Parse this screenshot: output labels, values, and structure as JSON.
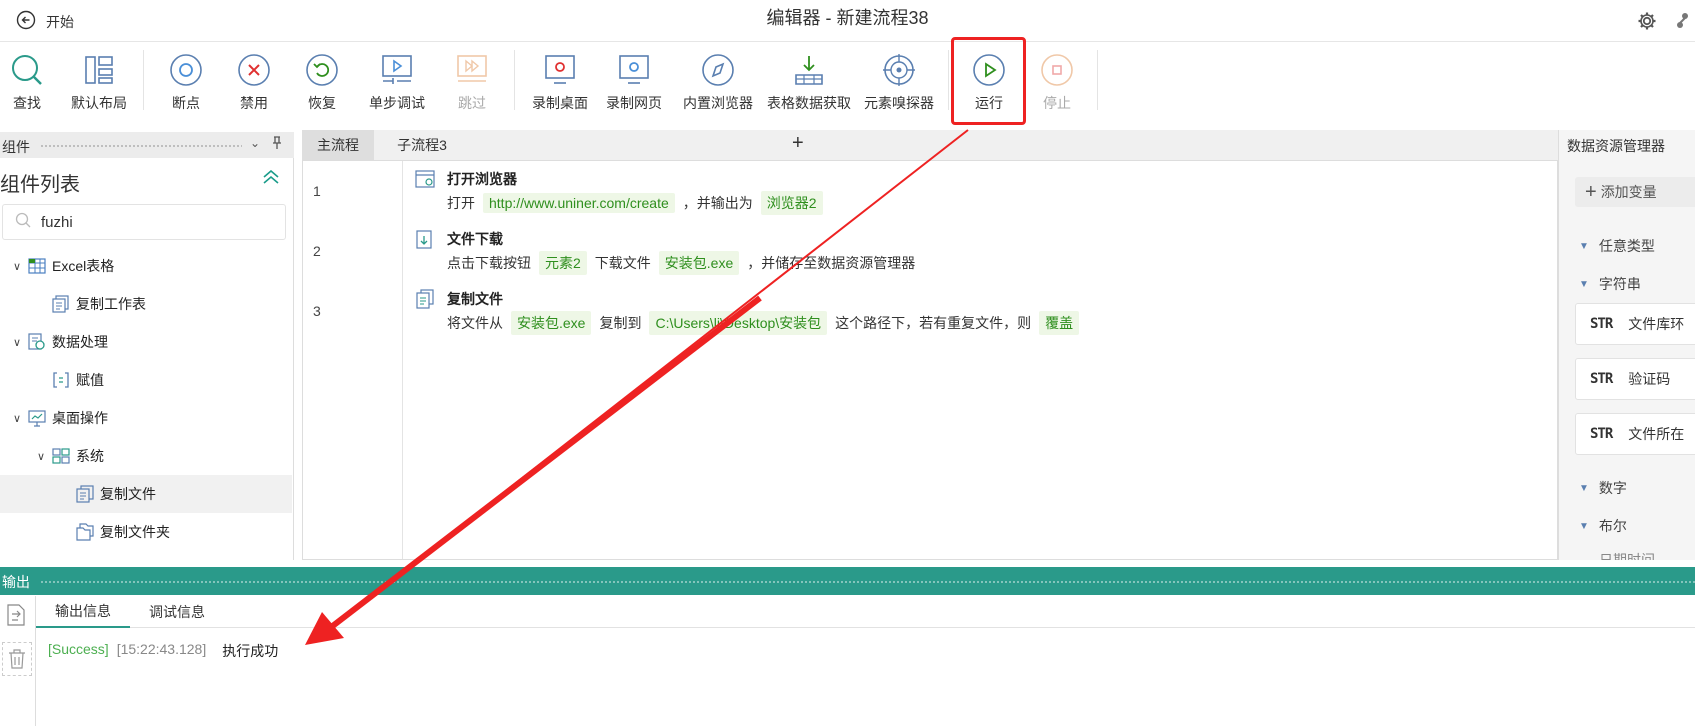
{
  "titlebar": {
    "back_label": "开始",
    "title": "编辑器 - 新建流程38"
  },
  "toolbar": {
    "items": [
      {
        "label": "查找",
        "icon": "search-icon"
      },
      {
        "label": "默认布局",
        "icon": "layout-icon"
      },
      {
        "label": "断点",
        "icon": "breakpoint-icon"
      },
      {
        "label": "禁用",
        "icon": "disable-icon"
      },
      {
        "label": "恢复",
        "icon": "restore-icon"
      },
      {
        "label": "单步调试",
        "icon": "step-debug-icon"
      },
      {
        "label": "跳过",
        "icon": "skip-icon",
        "disabled": true
      },
      {
        "label": "录制桌面",
        "icon": "record-desktop-icon"
      },
      {
        "label": "录制网页",
        "icon": "record-web-icon"
      },
      {
        "label": "内置浏览器",
        "icon": "browser-icon"
      },
      {
        "label": "表格数据获取",
        "icon": "table-data-icon"
      },
      {
        "label": "元素嗅探器",
        "icon": "element-sniffer-icon"
      },
      {
        "label": "运行",
        "icon": "run-icon"
      },
      {
        "label": "停止",
        "icon": "stop-icon",
        "disabled": true
      }
    ]
  },
  "left_panel": {
    "header": "组件",
    "title": "组件列表",
    "search_value": "fuzhi",
    "tree": [
      {
        "label": "Excel表格",
        "level": 0,
        "expanded": true,
        "icon": "excel-table-icon"
      },
      {
        "label": "复制工作表",
        "level": 1,
        "icon": "copy-sheet-icon"
      },
      {
        "label": "数据处理",
        "level": 0,
        "expanded": true,
        "icon": "data-processing-icon"
      },
      {
        "label": "赋值",
        "level": 1,
        "icon": "assign-icon"
      },
      {
        "label": "桌面操作",
        "level": 0,
        "expanded": true,
        "icon": "desktop-ops-icon"
      },
      {
        "label": "系统",
        "level": 1,
        "expanded": true,
        "icon": "system-icon"
      },
      {
        "label": "复制文件",
        "level": 2,
        "selected": true,
        "icon": "copy-file-icon"
      },
      {
        "label": "复制文件夹",
        "level": 2,
        "icon": "copy-folder-icon"
      }
    ]
  },
  "editor": {
    "tabs": [
      {
        "label": "主流程",
        "active": true
      },
      {
        "label": "子流程3",
        "active": false
      }
    ],
    "steps": [
      {
        "line": "1",
        "title": "打开浏览器",
        "icon": "open-browser-icon",
        "parts": [
          "打开",
          {
            "tok": "http://www.uniner.com/create"
          },
          "，并输出为",
          {
            "tok": "浏览器2"
          }
        ]
      },
      {
        "line": "2",
        "title": "文件下载",
        "icon": "file-download-icon",
        "parts": [
          "点击下载按钮",
          {
            "tok": "元素2"
          },
          "下载文件",
          {
            "tok": "安装包.exe"
          },
          "，并储存至数据资源管理器"
        ]
      },
      {
        "line": "3",
        "title": "复制文件",
        "icon": "copy-file-icon",
        "parts": [
          "将文件从",
          {
            "tok": "安装包.exe"
          },
          "复制到",
          {
            "tok": "C:\\Users\\li\\Desktop\\安装包"
          },
          "这个路径下，若有重复文件，则",
          {
            "tok": "覆盖"
          }
        ]
      }
    ]
  },
  "right_panel": {
    "title": "数据资源管理器",
    "add_variable": "添加变量",
    "categories": [
      {
        "label": "任意类型"
      },
      {
        "label": "字符串"
      },
      {
        "label": "数字"
      },
      {
        "label": "布尔"
      }
    ],
    "variables": [
      {
        "type": "STR",
        "name": "文件库环"
      },
      {
        "type": "STR",
        "name": "验证码"
      },
      {
        "type": "STR",
        "name": "文件所在"
      }
    ],
    "partial_item": "日期时间"
  },
  "output": {
    "header": "输出",
    "tabs": [
      {
        "label": "输出信息",
        "active": true
      },
      {
        "label": "调试信息",
        "active": false
      }
    ],
    "log": {
      "level": "[Success]",
      "time": "[15:22:43.128]",
      "message": "执行成功"
    }
  },
  "colors": {
    "accent": "#2a9a8a",
    "highlight": "#ee2222",
    "token_bg": "#eef7e6",
    "token_text": "#2f8f1e"
  }
}
